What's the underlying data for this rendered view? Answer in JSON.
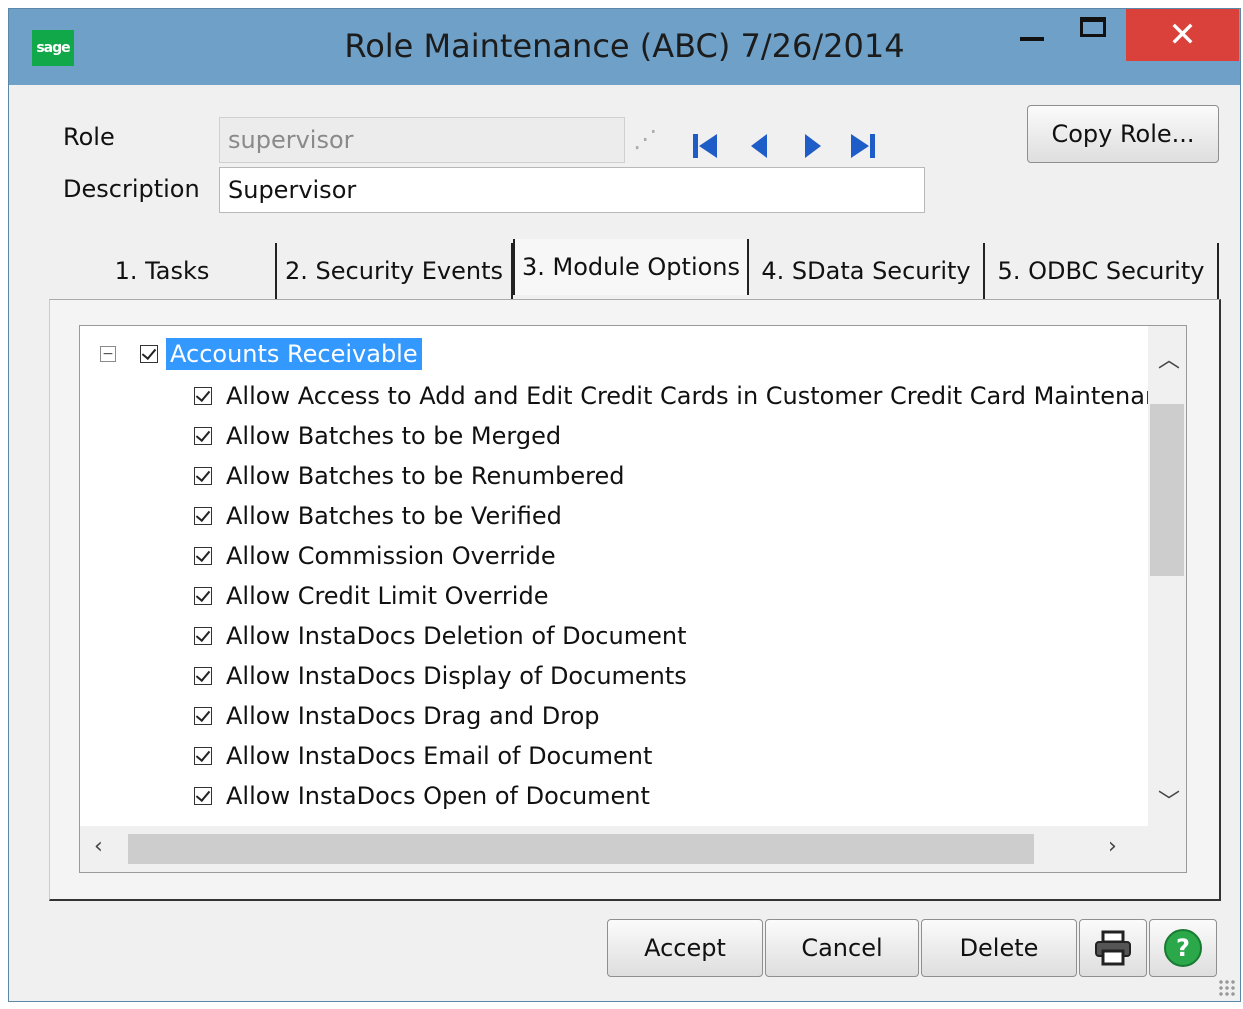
{
  "window": {
    "logo": "sage",
    "title": "Role Maintenance (ABC) 7/26/2014",
    "controls": {
      "minimize": "minimize",
      "maximize": "maximize",
      "close": "✕"
    }
  },
  "form": {
    "role_label": "Role",
    "role_value": "supervisor",
    "description_label": "Description",
    "description_value": "Supervisor",
    "copy_role_label": "Copy Role...",
    "nav_icons": [
      "first-record-icon",
      "previous-record-icon",
      "next-record-icon",
      "last-record-icon"
    ]
  },
  "tabs": [
    {
      "label": "1. Tasks",
      "active": false
    },
    {
      "label": "2. Security Events",
      "active": false
    },
    {
      "label": "3. Module Options",
      "active": true
    },
    {
      "label": "4. SData Security",
      "active": false
    },
    {
      "label": "5. ODBC Security",
      "active": false
    }
  ],
  "tree": {
    "root": {
      "label": "Accounts Receivable",
      "checked": true,
      "expanded": true
    },
    "items": [
      "Allow Access to Add and Edit Credit Cards in Customer Credit Card Maintenar",
      "Allow Batches to be Merged",
      "Allow Batches to be Renumbered",
      "Allow Batches to be Verified",
      "Allow Commission Override",
      "Allow Credit Limit Override",
      "Allow InstaDocs Deletion of Document",
      "Allow InstaDocs Display of Documents",
      "Allow InstaDocs Drag and Drop",
      "Allow InstaDocs Email of Document",
      "Allow InstaDocs Open of Document"
    ]
  },
  "buttons": {
    "accept": "Accept",
    "cancel": "Cancel",
    "delete": "Delete",
    "print_icon": "printer-icon",
    "help_icon": "help-icon"
  },
  "colors": {
    "titlebar": "#6fa0c7",
    "close_button": "#d9413a",
    "selection": "#3399ff",
    "nav_icon": "#1e5cc8",
    "help": "#2aa84a"
  }
}
